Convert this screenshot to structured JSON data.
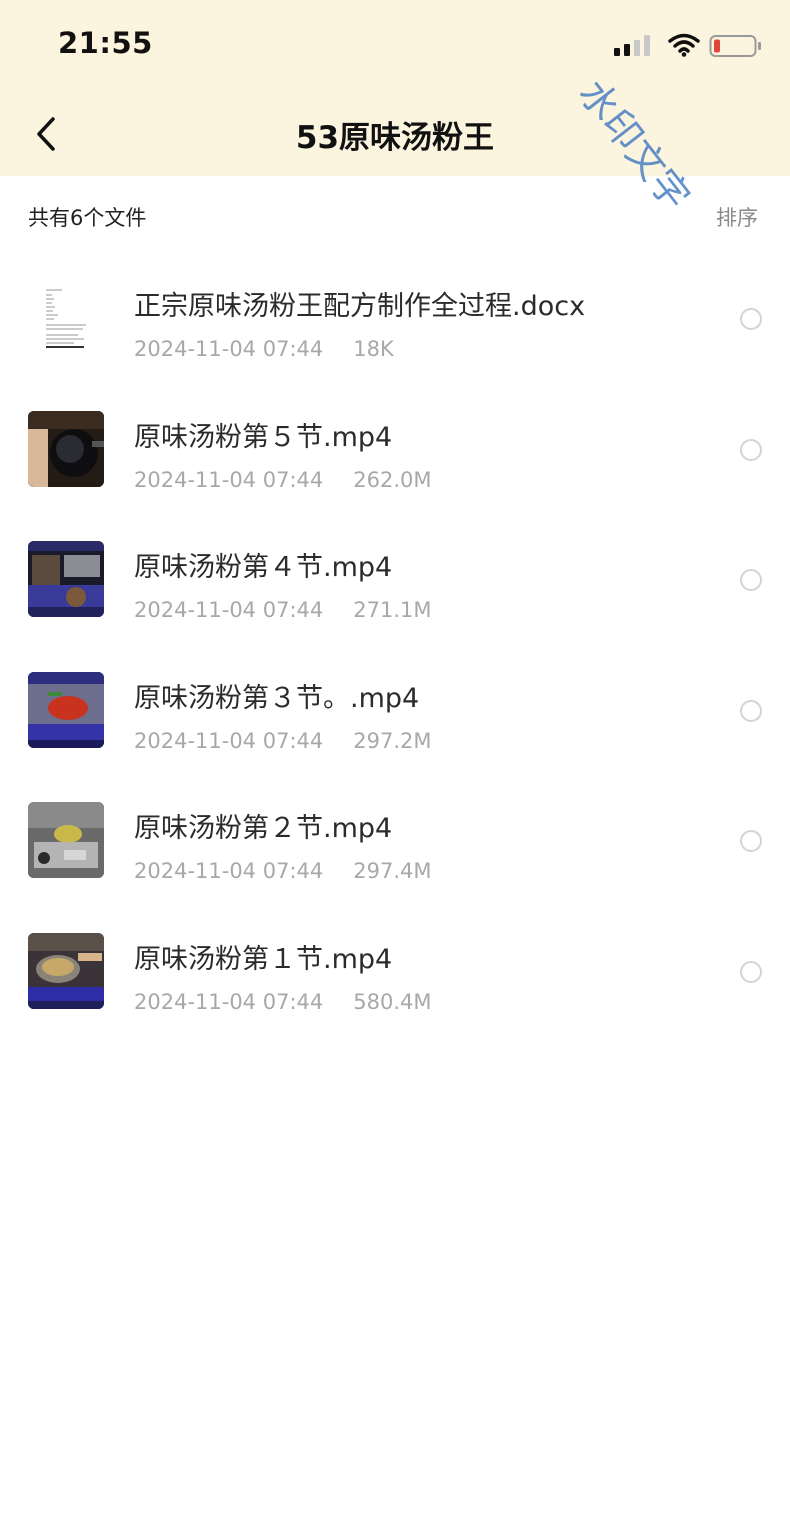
{
  "status_bar": {
    "time": "21:55",
    "icons": [
      "signal-icon",
      "wifi-icon",
      "battery-icon"
    ]
  },
  "nav": {
    "back_icon": "chevron-left-icon",
    "title": "53原味汤粉王"
  },
  "watermark": {
    "text": "水印文字",
    "color": "#4a7fc2"
  },
  "list_header": {
    "count_label": "共有6个文件",
    "sort_label": "排序"
  },
  "files": [
    {
      "name": "正宗原味汤粉王配方制作全过程.docx",
      "date": "2024-11-04 07:44",
      "size": "18K",
      "thumb": "document-thumbnail"
    },
    {
      "name": "原味汤粉第５节.mp4",
      "date": "2024-11-04 07:44",
      "size": "262.0M",
      "thumb": "video-thumbnail"
    },
    {
      "name": "原味汤粉第４节.mp4",
      "date": "2024-11-04 07:44",
      "size": "271.1M",
      "thumb": "video-thumbnail"
    },
    {
      "name": "原味汤粉第３节。.mp4",
      "date": "2024-11-04 07:44",
      "size": "297.2M",
      "thumb": "video-thumbnail"
    },
    {
      "name": "原味汤粉第２节.mp4",
      "date": "2024-11-04 07:44",
      "size": "297.4M",
      "thumb": "video-thumbnail"
    },
    {
      "name": "原味汤粉第１节.mp4",
      "date": "2024-11-04 07:44",
      "size": "580.4M",
      "thumb": "video-thumbnail"
    }
  ],
  "colors": {
    "header_bg": "#fbf4df",
    "text_primary": "#2b2b2b",
    "text_secondary": "#a8a8a8",
    "battery_low": "#e0463c"
  }
}
